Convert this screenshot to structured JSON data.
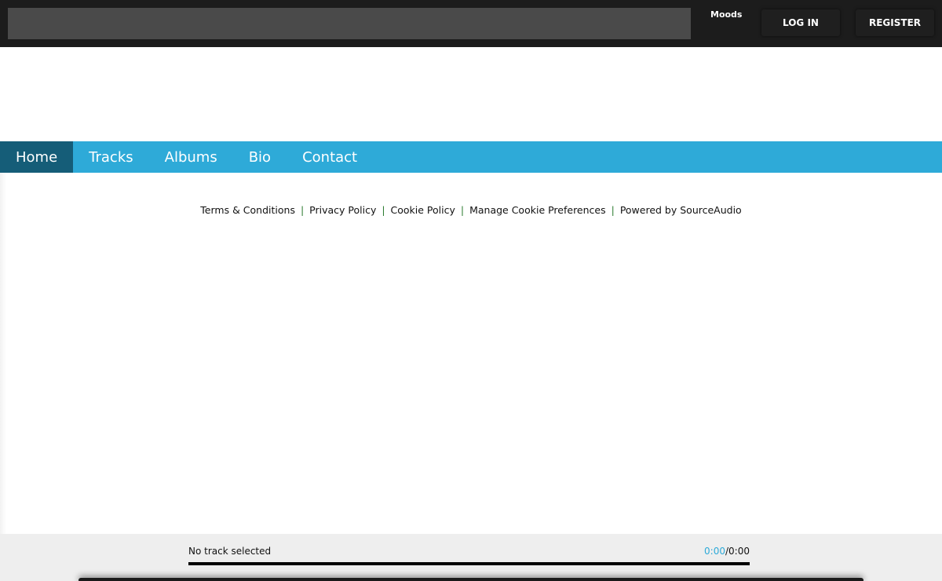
{
  "header": {
    "search_value": "",
    "moods_label": "Moods",
    "login_label": "LOG IN",
    "register_label": "REGISTER"
  },
  "nav": {
    "items": [
      {
        "label": "Home",
        "active": true
      },
      {
        "label": "Tracks",
        "active": false
      },
      {
        "label": "Albums",
        "active": false
      },
      {
        "label": "Bio",
        "active": false
      },
      {
        "label": "Contact",
        "active": false
      }
    ]
  },
  "footer": {
    "links": [
      "Terms & Conditions",
      "Privacy Policy",
      "Cookie Policy",
      "Manage Cookie Preferences",
      "Powered by SourceAudio"
    ],
    "separator": "|"
  },
  "player": {
    "track_label": "No track selected",
    "current_time": "0:00",
    "time_separator": "/",
    "total_time": "0:00",
    "progress": 0
  },
  "colors": {
    "accent": "#2eaad8",
    "nav_active": "#155d78",
    "topbar": "#1c1c1c"
  }
}
